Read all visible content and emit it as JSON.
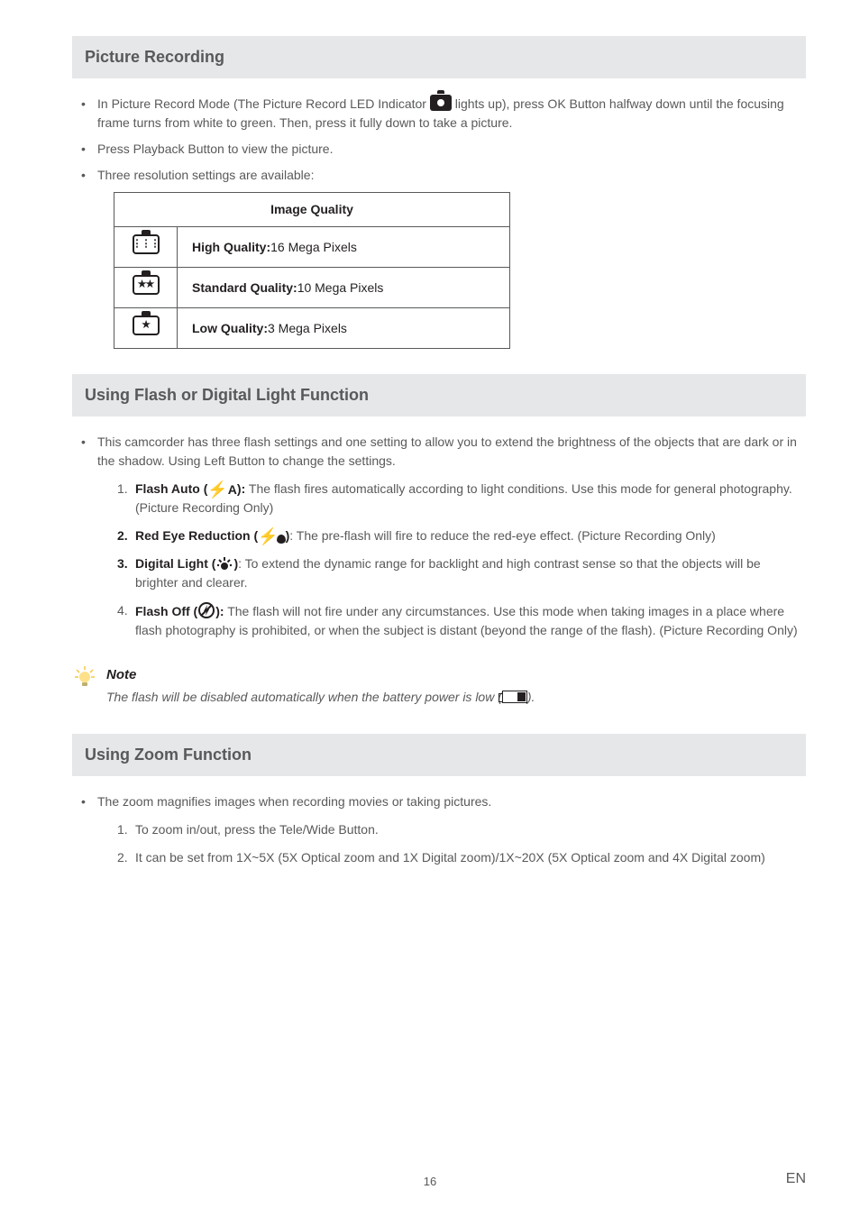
{
  "sections": {
    "pictureRecording": {
      "heading": "Picture Recording",
      "bullet1_a": "In Picture Record Mode (The Picture Record LED Indicator ",
      "bullet1_b": " lights up), press OK Button halfway down until the focusing frame turns from white to green. Then, press it fully down to take a picture.",
      "bullet2": "Press Playback Button to view the picture.",
      "bullet3": "Three resolution settings are available:",
      "tableHeader": "Image Quality",
      "rows": [
        {
          "stars": "⋮⋮⋮",
          "label_b": "High Quality:",
          "label_r": "16 Mega Pixels"
        },
        {
          "stars": "★★",
          "label_b": "Standard Quality:",
          "label_r": "10 Mega Pixels"
        },
        {
          "stars": "★",
          "label_b": "Low Quality:",
          "label_r": "3 Mega Pixels"
        }
      ]
    },
    "flash": {
      "heading": "Using Flash or Digital Light Function",
      "intro": "This camcorder has three flash settings and one setting to allow you to extend the brightness of the objects that are dark or in the shadow. Using Left Button to change the settings.",
      "items": [
        {
          "num": "1.",
          "title": "Flash Auto (",
          "title2": "):",
          "text": " The flash fires automatically according to light conditions. Use this mode for general photography. (Picture Recording Only)"
        },
        {
          "num": "2.",
          "title": "Red Eye Reduction (",
          "title2": ")",
          "text": ": The pre-flash will fire to reduce the red-eye effect. (Picture Recording Only)"
        },
        {
          "num": "3.",
          "title": "Digital Light (",
          "title2": ")",
          "text": ": To extend the dynamic range for backlight and high contrast sense so that the objects will be brighter and clearer."
        },
        {
          "num": "4.",
          "title": "Flash Off (",
          "title2": "):",
          "text": " The flash will not fire under any circumstances. Use this mode when taking images in a place where flash photography is prohibited, or when the subject is distant (beyond the range of the flash). (Picture Recording Only)"
        }
      ],
      "noteTitle": "Note",
      "noteText_a": "The flash will be disabled automatically when the battery power is low (",
      "noteText_b": ")."
    },
    "zoom": {
      "heading": "Using Zoom Function",
      "intro": "The zoom magnifies images when recording movies or taking pictures.",
      "items": [
        {
          "num": "1.",
          "text": "To zoom in/out, press the Tele/Wide Button."
        },
        {
          "num": "2.",
          "text": "It can be set from 1X~5X (5X Optical zoom and 1X Digital zoom)/1X~20X (5X Optical zoom and 4X Digital zoom)"
        }
      ]
    }
  },
  "footer": {
    "page": "16",
    "lang": "EN"
  }
}
